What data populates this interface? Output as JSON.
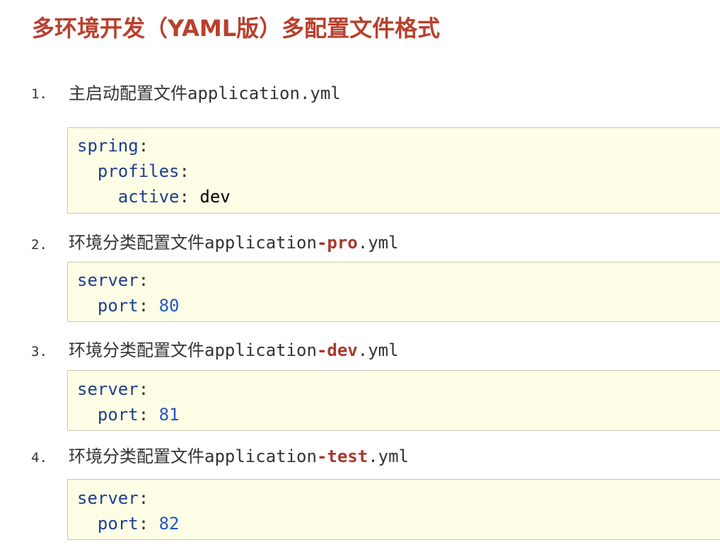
{
  "title": "多环境开发（YAML版）多配置文件格式",
  "items": [
    {
      "number": "1.",
      "heading_prefix": "主启动配置文件application.yml",
      "heading_highlight": "",
      "heading_suffix": "",
      "code": [
        {
          "key": "spring",
          "sep": ":",
          "value": ""
        },
        {
          "key": "profiles",
          "sep": ":",
          "value": ""
        },
        {
          "key": "active",
          "sep": ": ",
          "value": "dev"
        }
      ]
    },
    {
      "number": "2.",
      "heading_prefix": "环境分类配置文件application",
      "heading_highlight": "-pro",
      "heading_suffix": ".yml",
      "code": [
        {
          "key": "server",
          "sep": ":",
          "value": ""
        },
        {
          "key": "port",
          "sep": ": ",
          "value": "80"
        }
      ]
    },
    {
      "number": "3.",
      "heading_prefix": "环境分类配置文件application",
      "heading_highlight": "-dev",
      "heading_suffix": ".yml",
      "code": [
        {
          "key": "server",
          "sep": ":",
          "value": ""
        },
        {
          "key": "port",
          "sep": ": ",
          "value": "81"
        }
      ]
    },
    {
      "number": "4.",
      "heading_prefix": "环境分类配置文件application",
      "heading_highlight": "-test",
      "heading_suffix": ".yml",
      "code": [
        {
          "key": "server",
          "sep": ":",
          "value": ""
        },
        {
          "key": "port",
          "sep": ": ",
          "value": "82"
        }
      ]
    }
  ],
  "colors": {
    "title": "#b8402d",
    "highlight": "#a8392c",
    "code_key": "#1d3f8d",
    "code_number": "#2355c9",
    "code_background": "#fefde6"
  }
}
